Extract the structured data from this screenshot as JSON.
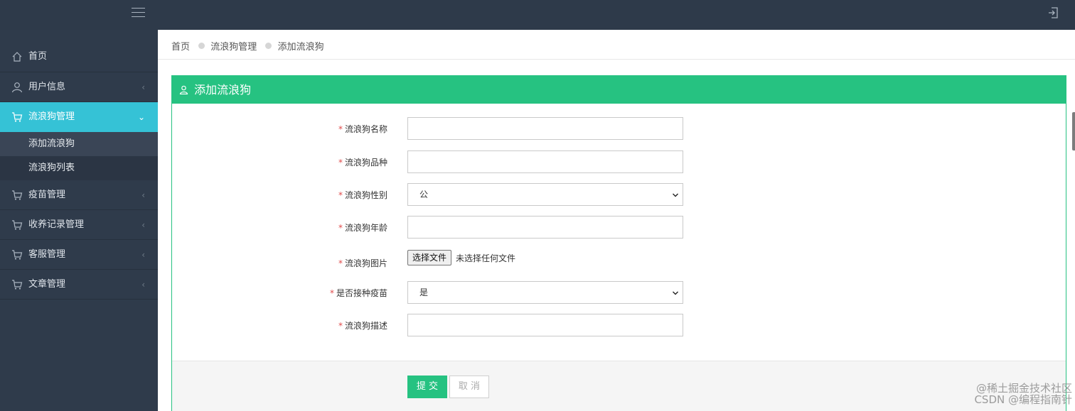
{
  "topbar": {
    "menu_icon": "hamburger-icon",
    "logout_icon": "logout-icon"
  },
  "sidebar": {
    "items": [
      {
        "label": "首页",
        "icon": "home-icon"
      },
      {
        "label": "用户信息",
        "icon": "user-icon",
        "chevron": "‹"
      },
      {
        "label": "流浪狗管理",
        "icon": "cart-icon",
        "chevron": "⌄",
        "active": true
      },
      {
        "label": "疫苗管理",
        "icon": "cart-icon",
        "chevron": "‹"
      },
      {
        "label": "收养记录管理",
        "icon": "cart-icon",
        "chevron": "‹"
      },
      {
        "label": "客服管理",
        "icon": "cart-icon",
        "chevron": "‹"
      },
      {
        "label": "文章管理",
        "icon": "cart-icon",
        "chevron": "‹"
      }
    ],
    "submenu": [
      {
        "label": "添加流浪狗"
      },
      {
        "label": "流浪狗列表"
      }
    ]
  },
  "breadcrumb": {
    "home": "首页",
    "section": "流浪狗管理",
    "current": "添加流浪狗"
  },
  "card": {
    "title": "添加流浪狗",
    "title_icon": "user-icon"
  },
  "form": {
    "required_mark": "*",
    "fields": [
      {
        "label": "流浪狗名称",
        "type": "text",
        "value": ""
      },
      {
        "label": "流浪狗品种",
        "type": "text",
        "value": ""
      },
      {
        "label": "流浪狗性别",
        "type": "select",
        "value": "公"
      },
      {
        "label": "流浪狗年龄",
        "type": "text",
        "value": ""
      },
      {
        "label": "流浪狗图片",
        "type": "file",
        "button": "选择文件",
        "status": "未选择任何文件"
      },
      {
        "label": "是否接种疫苗",
        "type": "select",
        "value": "是"
      },
      {
        "label": "流浪狗描述",
        "type": "text",
        "value": ""
      }
    ]
  },
  "actions": {
    "submit": "提 交",
    "cancel": "取 消"
  },
  "watermark": {
    "line1": "@稀土掘金技术社区",
    "line2": "CSDN @编程指南针"
  },
  "colors": {
    "topbar": "#2e3a4a",
    "sidebar": "#2f3b4b",
    "active_nav": "#35c2d6",
    "accent_green": "#26c281",
    "required": "#e04b4b"
  }
}
